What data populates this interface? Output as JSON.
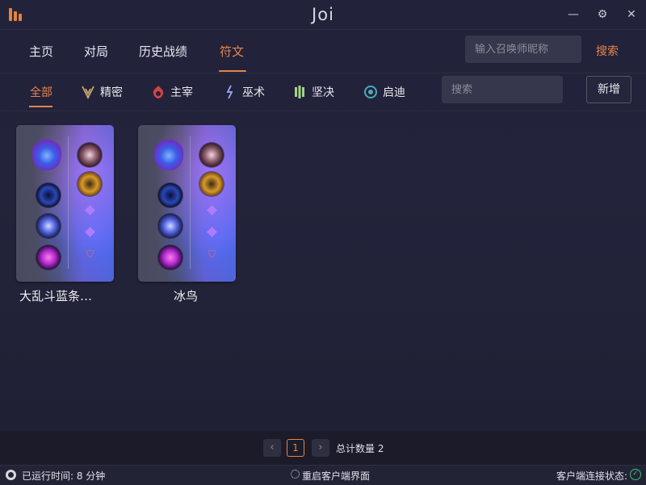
{
  "app": {
    "title": "Joi"
  },
  "window_controls": {
    "minimize": "—",
    "settings": "⚙",
    "close": "✕"
  },
  "main_nav": {
    "items": [
      {
        "label": "主页"
      },
      {
        "label": "对局"
      },
      {
        "label": "历史战绩"
      },
      {
        "label": "符文",
        "active": true
      }
    ],
    "summoner_search": {
      "placeholder": "输入召唤师昵称",
      "value": ""
    },
    "search_label": "搜索"
  },
  "rune_tabs": {
    "items": [
      {
        "label": "全部",
        "active": true
      },
      {
        "label": "精密",
        "icon": "precision-icon",
        "color": "#c8aa6e"
      },
      {
        "label": "主宰",
        "icon": "domination-icon",
        "color": "#d44242"
      },
      {
        "label": "巫术",
        "icon": "sorcery-icon",
        "color": "#9faafc"
      },
      {
        "label": "坚决",
        "icon": "resolve-icon",
        "color": "#a1d586"
      },
      {
        "label": "启迪",
        "icon": "inspiration-icon",
        "color": "#49aab9"
      }
    ],
    "search": {
      "placeholder": "搜索",
      "value": ""
    },
    "add_label": "新增"
  },
  "rune_pages": [
    {
      "name": "大乱斗蓝条…"
    },
    {
      "name": "冰鸟"
    }
  ],
  "pagination": {
    "prev": "‹",
    "current": "1",
    "next": "›",
    "total_text": "总计数量 2"
  },
  "status_bar": {
    "uptime": "已运行时间: 8 分钟",
    "restart": "重启客户端界面",
    "connection": "客户端连接状态:"
  },
  "colors": {
    "accent": "#e6844a",
    "connected": "#3cc36b"
  }
}
